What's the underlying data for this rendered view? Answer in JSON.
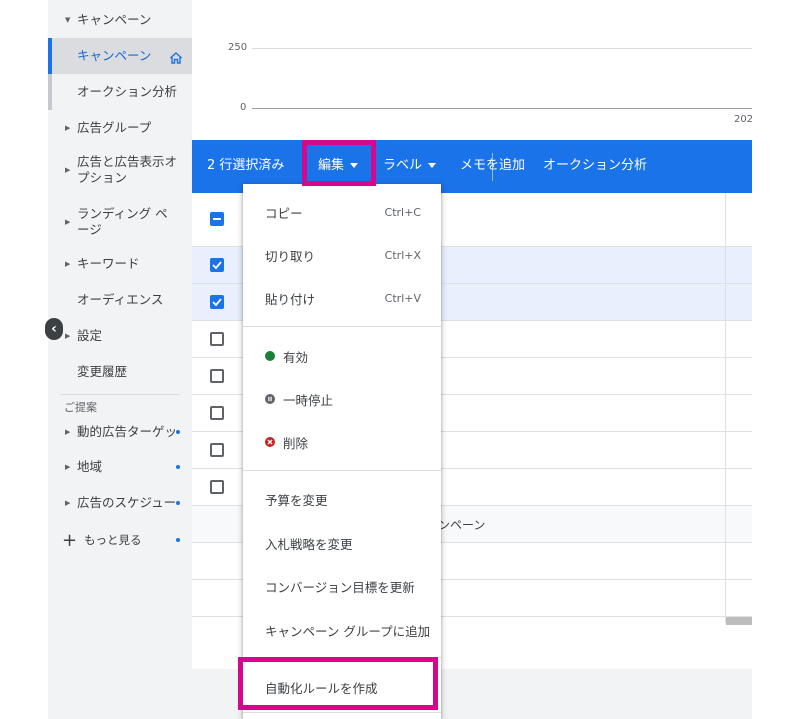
{
  "sidebar": {
    "items": [
      {
        "label": "キャンペーン"
      },
      {
        "label": "キャンペーン"
      },
      {
        "label": "オークション分析"
      },
      {
        "label": "広告グループ"
      },
      {
        "label": "広告と広告表示オプション"
      },
      {
        "label": "ランディング ページ"
      },
      {
        "label": "キーワード"
      },
      {
        "label": "オーディエンス"
      },
      {
        "label": "設定"
      },
      {
        "label": "変更履歴"
      }
    ],
    "suggestions_header": "ご提案",
    "suggestions": [
      {
        "label": "動的広告ターゲッ"
      },
      {
        "label": "地域"
      },
      {
        "label": "広告のスケジュー"
      }
    ],
    "more_label": "もっと見る",
    "plus_glyph": "+",
    "collapse_glyph": "‹"
  },
  "chart": {
    "y_ticks": [
      "250",
      "0"
    ],
    "x_tick": "202"
  },
  "actionbar": {
    "selected_label": "2 行選択済み",
    "edit_label": "編集",
    "label_label": "ラベル",
    "memo_label": "メモを追加",
    "auction_label": "オークション分析"
  },
  "table": {
    "rows": [
      {
        "checkbox": "indeterminate"
      },
      {
        "checkbox": "checked"
      },
      {
        "checkbox": "checked"
      },
      {
        "checkbox": "unchecked"
      },
      {
        "checkbox": "unchecked"
      },
      {
        "checkbox": "unchecked"
      },
      {
        "checkbox": "unchecked"
      },
      {
        "checkbox": "unchecked"
      }
    ],
    "partial_text": "ンペーン"
  },
  "menu": {
    "copy": {
      "label": "コピー",
      "shortcut": "Ctrl+C"
    },
    "cut": {
      "label": "切り取り",
      "shortcut": "Ctrl+X"
    },
    "paste": {
      "label": "貼り付け",
      "shortcut": "Ctrl+V"
    },
    "enable": {
      "label": "有効",
      "color": "#188038"
    },
    "pause": {
      "label": "一時停止",
      "color": "#5f6368"
    },
    "remove": {
      "label": "削除",
      "color": "#c5221f"
    },
    "change_budget": "予算を変更",
    "change_bidding": "入札戦略を変更",
    "update_conversion": "コンバージョン目標を更新",
    "add_to_group": "キャンペーン グループに追加",
    "create_rule": "自動化ルールを作成"
  },
  "colors": {
    "accent": "#1a73e8",
    "highlight": "#d4088f"
  }
}
